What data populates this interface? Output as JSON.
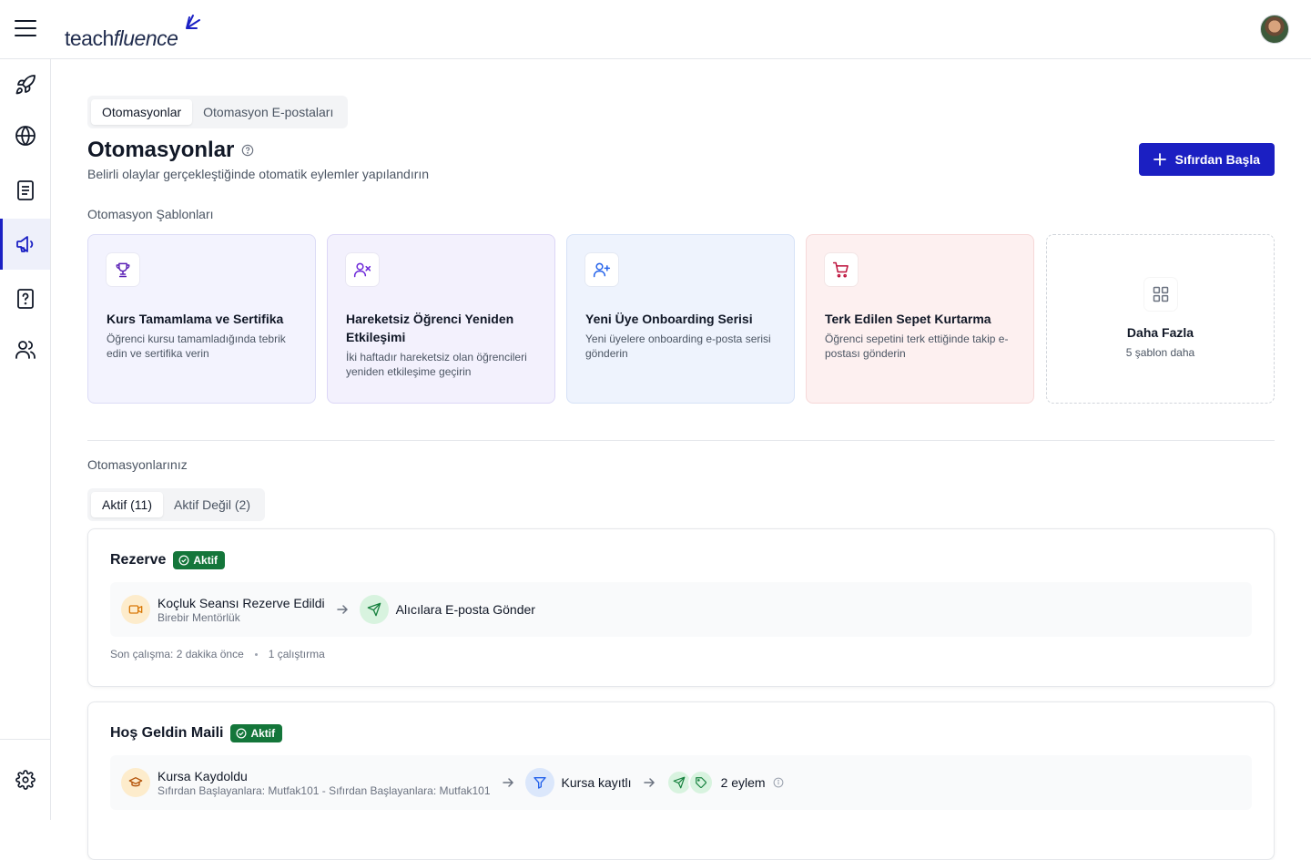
{
  "header": {
    "logo_part1": "teach",
    "logo_part2": "fluence"
  },
  "sidebar": {
    "items": [
      {
        "name": "rocket-icon"
      },
      {
        "name": "globe-icon"
      },
      {
        "name": "document-icon"
      },
      {
        "name": "megaphone-icon",
        "active": true
      },
      {
        "name": "help-file-icon"
      },
      {
        "name": "users-icon"
      }
    ],
    "footer_icon": "gear-icon"
  },
  "tabs": {
    "automations": "Otomasyonlar",
    "emails": "Otomasyon E-postaları"
  },
  "page": {
    "title": "Otomasyonlar",
    "subtitle": "Belirli olaylar gerçekleştiğinde otomatik eylemler yapılandırın",
    "primary_button": "Sıfırdan Başla"
  },
  "templates_section": {
    "label": "Otomasyon Şablonları",
    "items": [
      {
        "title": "Kurs Tamamlama ve Sertifika",
        "desc": "Öğrenci kursu tamamladığında tebrik edin ve sertifika verin",
        "icon": "trophy-icon"
      },
      {
        "title": "Hareketsiz Öğrenci Yeniden Etkileşimi",
        "desc": "İki haftadır hareketsiz olan öğrencileri yeniden etkileşime geçirin",
        "icon": "user-x-icon"
      },
      {
        "title": "Yeni Üye Onboarding Serisi",
        "desc": "Yeni üyelere onboarding e-posta serisi gönderin",
        "icon": "user-plus-icon"
      },
      {
        "title": "Terk Edilen Sepet Kurtarma",
        "desc": "Öğrenci sepetini terk ettiğinde takip e-postası gönderin",
        "icon": "cart-icon"
      }
    ],
    "more": {
      "title": "Daha Fazla",
      "desc": "5 şablon daha"
    }
  },
  "yours_section": {
    "label": "Otomasyonlarınız",
    "tab_active": "Aktif (11)",
    "tab_inactive": "Aktif Değil (2)"
  },
  "cards": [
    {
      "title": "Rezerve",
      "badge": "Aktif",
      "trigger": "Koçluk Seansı Rezerve Edildi",
      "trigger_sub": "Birebir Mentörlük",
      "action": "Alıcılara E-posta Gönder",
      "last_run": "Son çalışma: 2 dakika önce",
      "runs": "1 çalıştırma"
    },
    {
      "title": "Hoş Geldin Maili",
      "badge": "Aktif",
      "trigger": "Kursa Kaydoldu",
      "trigger_sub": "Sıfırdan Başlayanlara: Mutfak101 - Sıfırdan Başlayanlara: Mutfak101",
      "filter": "Kursa kayıtlı",
      "actions": "2 eylem"
    }
  ],
  "colors": {
    "accent": "#1b1fc2",
    "active_badge": "#14763a"
  }
}
